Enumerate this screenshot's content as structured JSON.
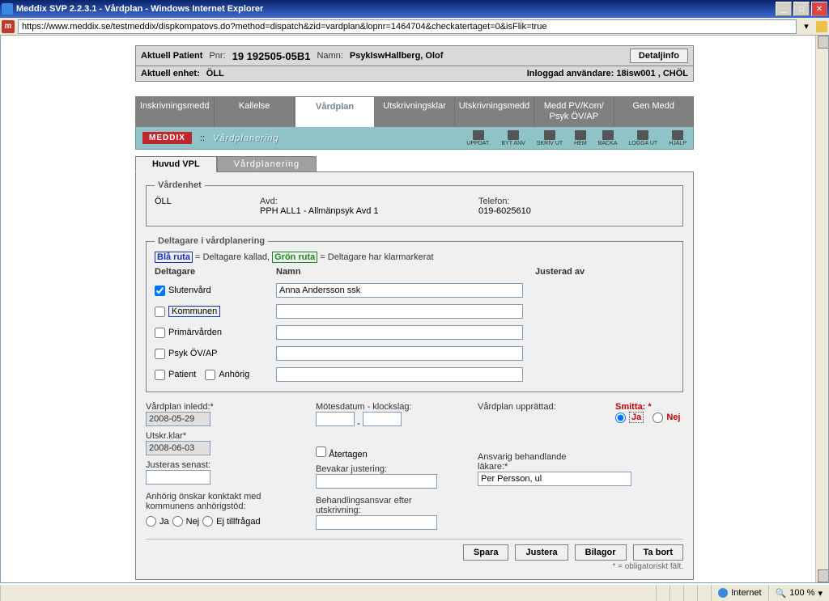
{
  "window": {
    "title": "Meddix SVP 2.2.3.1 - Vårdplan - Windows Internet Explorer",
    "url": "https://www.meddix.se/testmeddix/dispkompatovs.do?method=dispatch&zid=vardplan&lopnr=1464704&checkatertaget=0&isFlik=true"
  },
  "patient": {
    "label": "Aktuell Patient",
    "pnr_label": "Pnr:",
    "pnr": "19 192505-05B1",
    "name_label": "Namn:",
    "name": "PsykIswHallberg, Olof",
    "detail_btn": "Detaljinfo",
    "unit_label": "Aktuell enhet:",
    "unit": "ÖLL",
    "logged_label": "Inloggad användare:",
    "logged": "18isw001 , CHÖL"
  },
  "nav": {
    "tabs": [
      "Inskrivningsmedd",
      "Kallelse",
      "Vårdplan",
      "Utskrivningsklar",
      "Utskrivningsmedd",
      "Medd PV/Kom/ Psyk ÖV/AP",
      "Gen Medd"
    ],
    "active": "Vårdplan"
  },
  "toolbar": {
    "brand": "MEDDIX",
    "title": "Vårdplanering",
    "icons": [
      "UPPDAT.",
      "BYT ANV",
      "SKRIV UT",
      "HEM",
      "BACKA",
      "LOGGA UT",
      "HJÄLP"
    ]
  },
  "subtabs": {
    "a": "Huvud VPL",
    "b": "Vårdplanering"
  },
  "vardenhet": {
    "legend": "Vårdenhet",
    "unit": "ÖLL",
    "avd_label": "Avd:",
    "avd": "PPH ALL1 - Allmänpsyk Avd 1",
    "tel_label": "Telefon:",
    "tel": "019-6025610"
  },
  "deltagare": {
    "legend": "Deltagare i vårdplanering",
    "blue": "Blå ruta",
    "blue_txt": " = Deltagare kallad,   ",
    "green": "Grön ruta",
    "green_txt": " = Deltagare har klarmarkerat",
    "head1": "Deltagare",
    "head2": "Namn",
    "head3": "Justerad av",
    "rows": {
      "slutenvard": "Slutenvård",
      "slutenvard_name": "Anna Andersson ssk",
      "kommunen": "Kommunen",
      "primarvarden": "Primärvården",
      "psyk": "Psyk ÖV/AP",
      "patient": "Patient",
      "anhorig": "Anhörig"
    }
  },
  "fields": {
    "inledd_label": "Vårdplan inledd:*",
    "inledd": "2008-05-29",
    "utskr_label": "Utskr.klar*",
    "utskr": "2008-06-03",
    "justeras_label": "Justeras senast:",
    "anhorig_label": "Anhörig önskar konktakt med kommunens anhörigstöd:",
    "ja": "Ja",
    "nej": "Nej",
    "ej": "Ej tillfrågad",
    "motes_label": "Mötesdatum - klockslag:",
    "atertagen": "Återtagen",
    "bevakar_label": "Bevakar justering:",
    "behand_label": "Behandlingsansvar efter utskrivning:",
    "uppr_label": "Vårdplan upprättad:",
    "ansvarig_label": "Ansvarig behandlande läkare:*",
    "ansvarig": "Per Persson, ul",
    "smitta_label": "Smitta: *",
    "smitta_ja": "Ja",
    "smitta_nej": "Nej"
  },
  "buttons": {
    "spara": "Spara",
    "justera": "Justera",
    "bilagor": "Bilagor",
    "tabort": "Ta bort"
  },
  "oblig": "* = obligatoriskt fält.",
  "statusbar": {
    "internet": "Internet",
    "zoom": "100 %"
  }
}
